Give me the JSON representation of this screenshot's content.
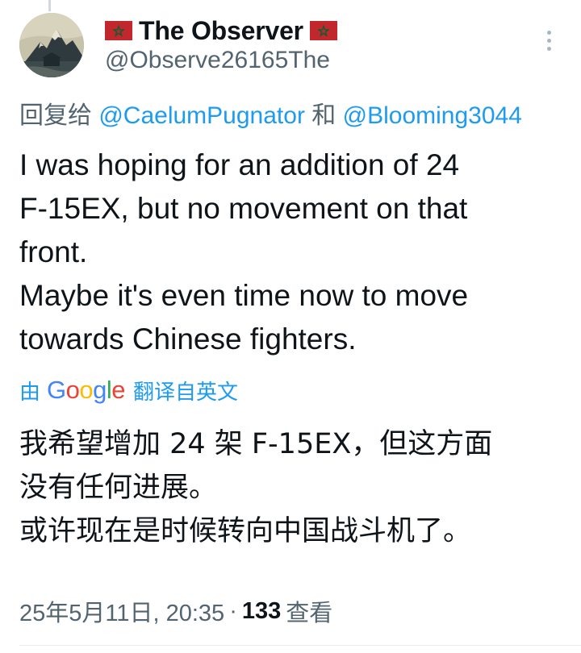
{
  "author": {
    "display_name": "The Observer",
    "handle": "@Observe26165The",
    "flag_icon": "morocco-flag-icon",
    "flag_colors": {
      "field": "#c1272d",
      "star": "#006233"
    }
  },
  "reply_to": {
    "prefix": "回复给",
    "mention_1": "@CaelumPugnator",
    "conjunction": "和",
    "mention_2": "@Blooming3044"
  },
  "tweet": {
    "lines": [
      "I was hoping for an addition of 24",
      "F-15EX, but no movement on that",
      "front.",
      "Maybe it's even time now to move",
      "towards Chinese fighters."
    ]
  },
  "translation": {
    "prefix": "由",
    "provider": "Google",
    "suffix": "翻译自英文",
    "lines": [
      "我希望增加 24 架 F-15EX，但这方面",
      "没有任何进展。",
      "或许现在是时候转向中国战斗机了。"
    ]
  },
  "meta": {
    "timestamp": "25年5月11日, 20:35",
    "separator": "·",
    "views_count": "133",
    "views_label": "查看"
  },
  "colors": {
    "link": "#1d9bf0",
    "secondary_text": "#536471",
    "primary_text": "#0f1419",
    "google_blue": "#4285f4",
    "google_red": "#ea4335",
    "google_yellow": "#fbbc05",
    "google_green": "#34a853"
  },
  "icons": {
    "more": "more-options-icon"
  }
}
